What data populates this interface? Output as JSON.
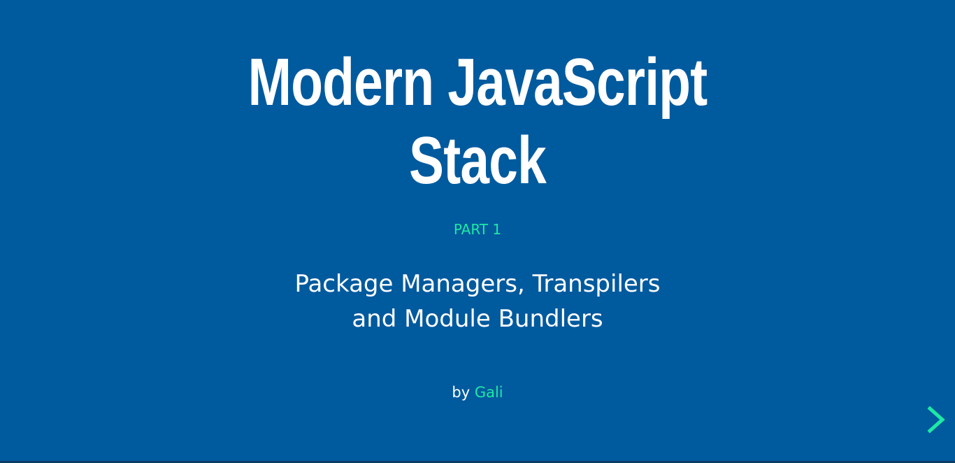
{
  "slide": {
    "title_line1": "Modern JavaScript",
    "title_line2": "Stack",
    "part": "PART 1",
    "subtitle_line1": "Package Managers, Transpilers",
    "subtitle_line2": "and Module Bundlers",
    "by_label": "by",
    "author": "Gali"
  },
  "navigation": {
    "next_icon": "chevron-right-icon"
  },
  "colors": {
    "background": "#005a9e",
    "accent": "#1de9a4",
    "text": "#ffffff"
  }
}
